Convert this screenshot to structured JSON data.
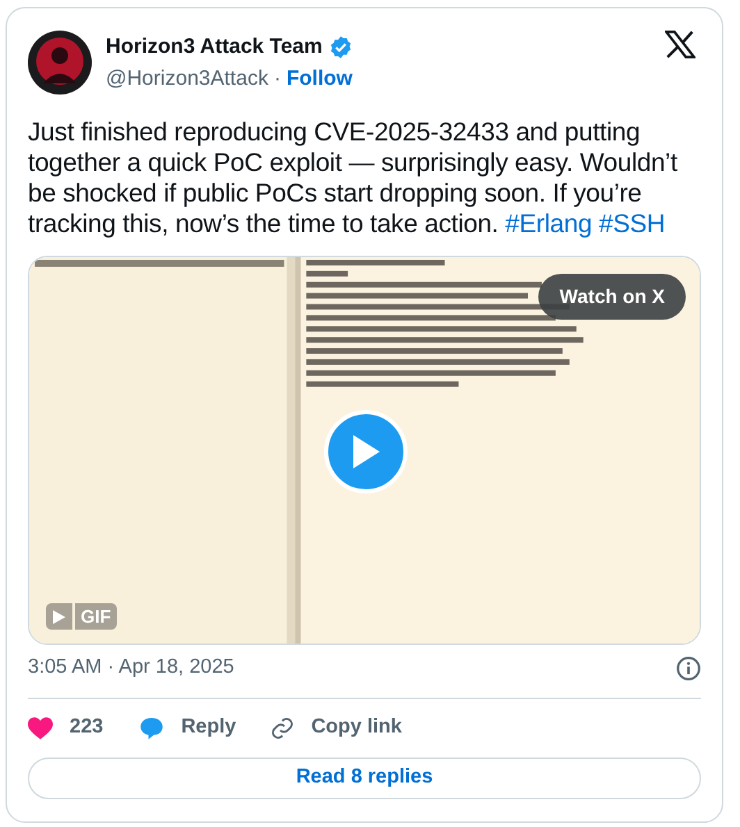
{
  "author": {
    "name": "Horizon3 Attack Team",
    "verified": true,
    "handle": "@Horizon3Attack",
    "separator": "·",
    "follow": "Follow"
  },
  "post": {
    "text": "Just finished reproducing CVE-2025-32433 and putting together a quick PoC exploit — surprisingly easy. Wouldn’t be shocked if public PoCs start dropping soon. If you’re tracking this, now’s the time to take action.",
    "hashtags": [
      "#Erlang",
      "#SSH"
    ]
  },
  "media": {
    "kind": "picture",
    "watch_button": "Watch on X",
    "badge": "GIF"
  },
  "timestamp": "3:05 AM · Apr 18, 2025",
  "actions": {
    "likes": "223",
    "reply": "Reply",
    "copy_link": "Copy link"
  },
  "read_replies": "Read 8 replies"
}
